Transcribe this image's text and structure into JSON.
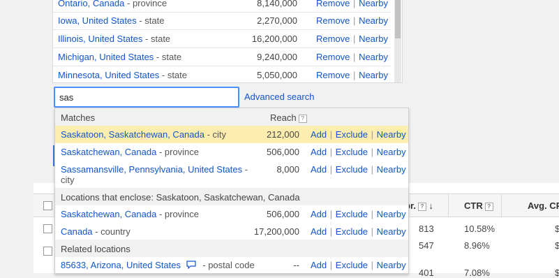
{
  "targets": {
    "rows": [
      {
        "name": "Ontario, Canada",
        "type": "- province",
        "reach": "8,140,000",
        "remove": "Remove",
        "nearby": "Nearby"
      },
      {
        "name": "Iowa, United States",
        "type": "- state",
        "reach": "2,270,000",
        "remove": "Remove",
        "nearby": "Nearby"
      },
      {
        "name": "Illinois, United States",
        "type": "- state",
        "reach": "16,200,000",
        "remove": "Remove",
        "nearby": "Nearby"
      },
      {
        "name": "Michigan, United States",
        "type": "- state",
        "reach": "9,240,000",
        "remove": "Remove",
        "nearby": "Nearby"
      },
      {
        "name": "Minnesota, United States",
        "type": "- state",
        "reach": "5,050,000",
        "remove": "Remove",
        "nearby": "Nearby"
      }
    ]
  },
  "search": {
    "value": "sas",
    "advanced_label": "Advanced search"
  },
  "dropdown": {
    "header_matches": "Matches",
    "header_reach": "Reach",
    "help": "?",
    "actions": {
      "add": "Add",
      "exclude": "Exclude",
      "nearby": "Nearby"
    },
    "matches": [
      {
        "name": "Saskatoon, Saskatchewan, Canada",
        "type": "- city",
        "reach": "212,000",
        "highlighted": true
      },
      {
        "name": "Saskatchewan, Canada",
        "type": "- province",
        "reach": "506,000"
      },
      {
        "name": "Sassamansville, Pennsylvania, United States",
        "type": "- city",
        "reach": "8,000"
      }
    ],
    "enclose_header": "Locations that enclose: Saskatoon, Saskatchewan, Canada",
    "enclose": [
      {
        "name": "Saskatchewan, Canada",
        "type": "- province",
        "reach": "506,000"
      },
      {
        "name": "Canada",
        "type": "- country",
        "reach": "17,200,000"
      }
    ],
    "related_header": "Related locations",
    "related": [
      {
        "name": "85633, Arizona, United States",
        "type": "- postal code",
        "reach": "--"
      }
    ]
  },
  "table": {
    "col_ctr": "CTR",
    "col_avg": "Avg. CP",
    "col_partial": "pr.",
    "help": "?",
    "rows": [
      {
        "clicks": "813",
        "ctr": "10.58%",
        "cpc": "$"
      },
      {
        "clicks": "547",
        "ctr": "8.96%",
        "cpc": "$"
      },
      {
        "clicks": "401",
        "ctr": "7.08%",
        "cpc": "$"
      }
    ]
  },
  "colors": {
    "link": "#1155cc",
    "highlight": "#fdeeb0",
    "focus": "#4d90fe"
  }
}
